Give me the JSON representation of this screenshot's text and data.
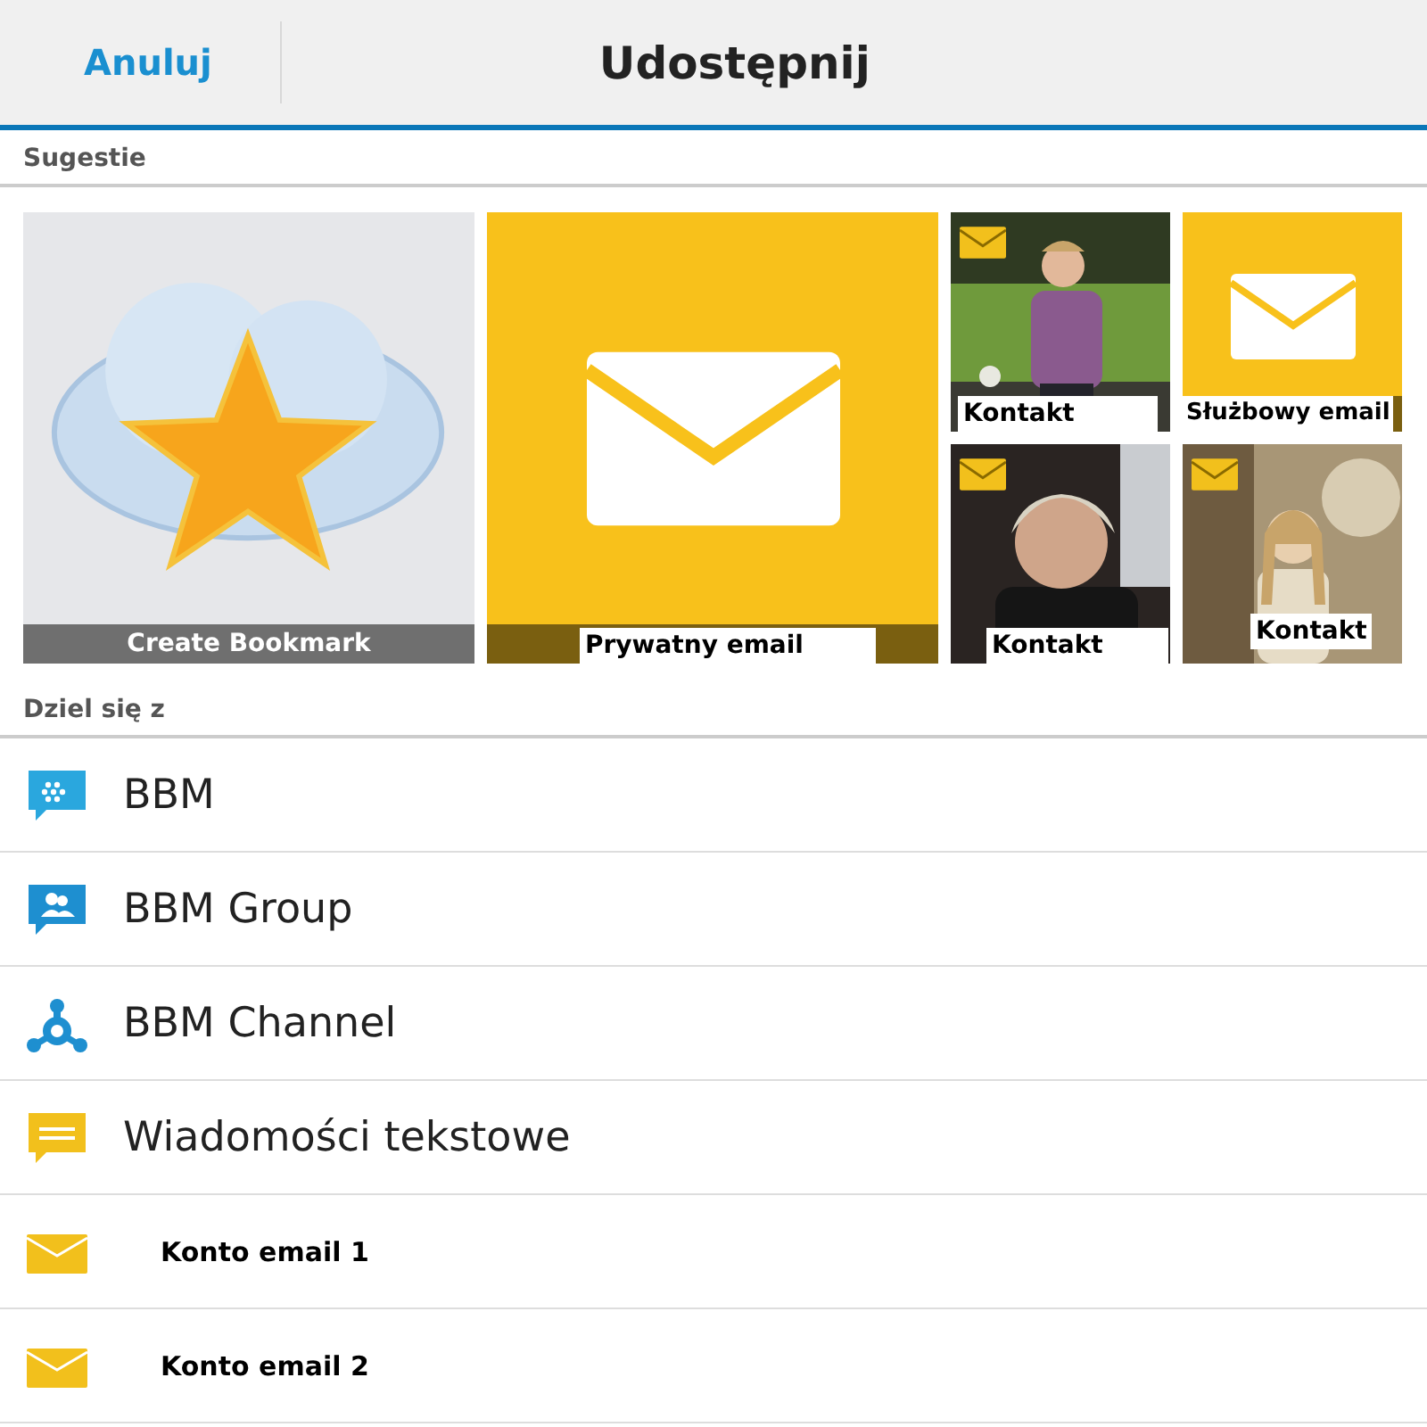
{
  "header": {
    "cancel": "Anuluj",
    "title": "Udostępnij"
  },
  "suggestions": {
    "heading": "Sugestie",
    "tiles": [
      {
        "kind": "bookmark",
        "label": "Create Bookmark"
      },
      {
        "kind": "email",
        "label": "Prywatny email"
      },
      {
        "kind": "contact",
        "label": "Kontakt"
      },
      {
        "kind": "email-small",
        "label": "Służbowy email"
      },
      {
        "kind": "contact",
        "label": "Kontakt"
      },
      {
        "kind": "contact",
        "label": "Kontakt"
      }
    ]
  },
  "share": {
    "heading": "Dziel się z",
    "items": [
      {
        "kind": "bbm",
        "label": "BBM"
      },
      {
        "kind": "bbm-group",
        "label": "BBM Group"
      },
      {
        "kind": "bbm-channel",
        "label": "BBM Channel"
      },
      {
        "kind": "sms",
        "label": "Wiadomości tekstowe"
      },
      {
        "kind": "email-account",
        "label": "Konto email 1"
      },
      {
        "kind": "email-account",
        "label": "Konto email 2"
      }
    ]
  }
}
